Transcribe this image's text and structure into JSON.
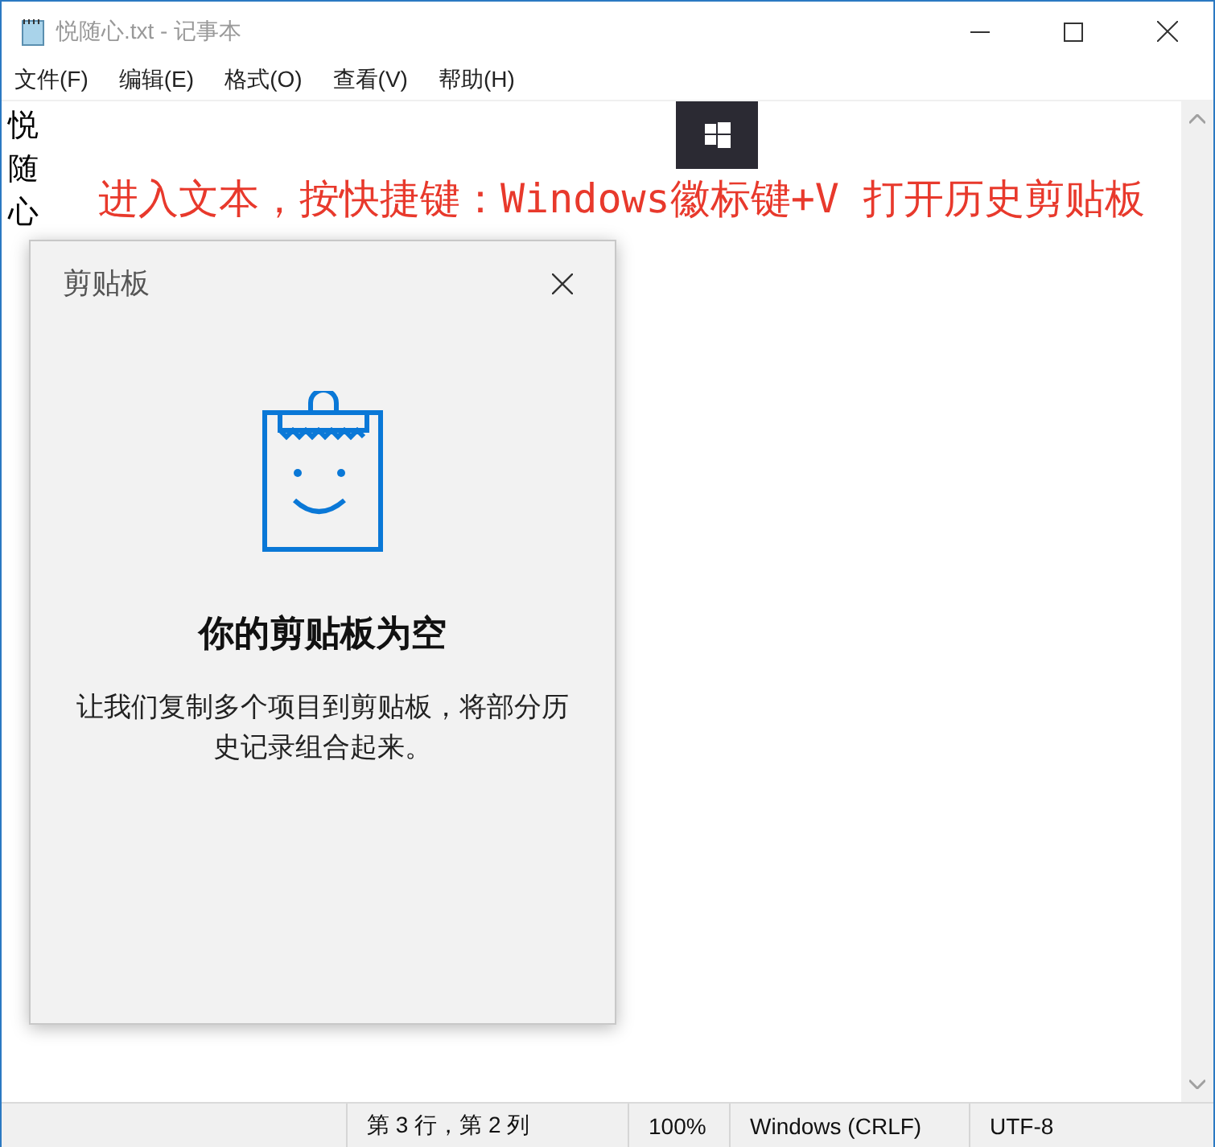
{
  "window": {
    "title": "悦随心.txt - 记事本"
  },
  "menu": [
    {
      "label": "文件(F)"
    },
    {
      "label": "编辑(E)"
    },
    {
      "label": "格式(O)"
    },
    {
      "label": "查看(V)"
    },
    {
      "label": "帮助(H)"
    }
  ],
  "editor": {
    "lines": [
      "悦",
      "随",
      "心"
    ]
  },
  "annotation": {
    "text": "进入文本，按快捷键：Windows徽标键+V 打开历史剪贴板"
  },
  "clipboard_panel": {
    "title": "剪贴板",
    "heading": "你的剪贴板为空",
    "message": "让我们复制多个项目到剪贴板，将部分历史记录组合起来。"
  },
  "status_bar": [
    {
      "text": "第 3 行，第 2 列"
    },
    {
      "text": "100%"
    },
    {
      "text": "Windows (CRLF)"
    },
    {
      "text": "UTF-8"
    }
  ]
}
